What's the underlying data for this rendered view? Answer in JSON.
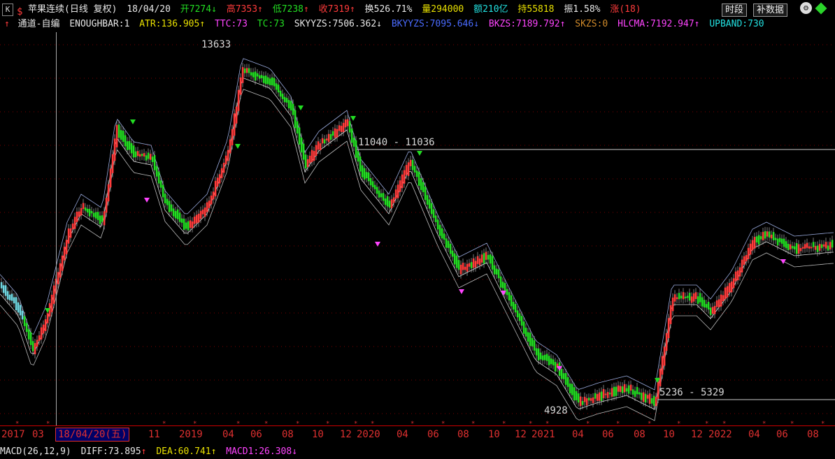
{
  "header": {
    "k_button": "K",
    "title": "苹果连续(日线 复权)",
    "date": "18/04/20",
    "open": "开7274",
    "open_arrow": "↓",
    "high": "高7353",
    "high_arrow": "↑",
    "low": "低7238",
    "low_arrow": "↑",
    "close": "收7319",
    "close_arrow": "↑",
    "turnover": "换526.71%",
    "volume": "量294000",
    "amount": "额210亿",
    "hold": "持55818",
    "amplitude": "振1.58%",
    "change": "涨(18)",
    "time_button": "时段",
    "fill_button": "补数据"
  },
  "indicator_line": {
    "name": "通道-自编",
    "params": "ENOUGHBAR:1",
    "atr": "ATR:136.905",
    "atr_arrow": "↑",
    "ttc": "TTC:73",
    "tc": "TC:73",
    "skyyzs": "SKYYZS:7506.362",
    "skyyzs_arrow": "↓",
    "bkyyzs": "BKYYZS:7095.646",
    "bkyyzs_arrow": "↓",
    "bkzs": "BKZS:7189.792",
    "bkzs_arrow": "↑",
    "skzs": "SKZS:0",
    "hlcma": "HLCMA:7192.947",
    "hlcma_arrow": "↑",
    "upband": "UPBAND:730"
  },
  "chart_annotations": {
    "high_label": "13633",
    "resistance_label": "11040 - 11036",
    "support_label": "5236 - 5329",
    "low_label": "4928"
  },
  "x_axis": {
    "ticks": [
      "2017",
      "03",
      "11",
      "2019",
      "04",
      "06",
      "08",
      "10",
      "12",
      "2020",
      "04",
      "06",
      "08",
      "10",
      "12",
      "2021",
      "04",
      "06",
      "08",
      "10",
      "12",
      "2022",
      "04",
      "06",
      "08"
    ],
    "selected_date": "18/04/20(五)"
  },
  "macd_line": {
    "name": "MACD(26,12,9)",
    "diff": "DIFF:73.895",
    "diff_arrow": "↑",
    "dea": "DEA:60.741",
    "dea_arrow": "↑",
    "macd1": "MACD1:26.308",
    "macd1_arrow": "↓"
  },
  "colors": {
    "up": "#ff3b3b",
    "down": "#22dd22",
    "channel": "#dddddd",
    "axis": "#e03030",
    "support": "#8a8a8a"
  },
  "icons": {
    "settings": "gear-icon",
    "status": "green-diamond-icon",
    "sign": "dollar-icon"
  }
}
